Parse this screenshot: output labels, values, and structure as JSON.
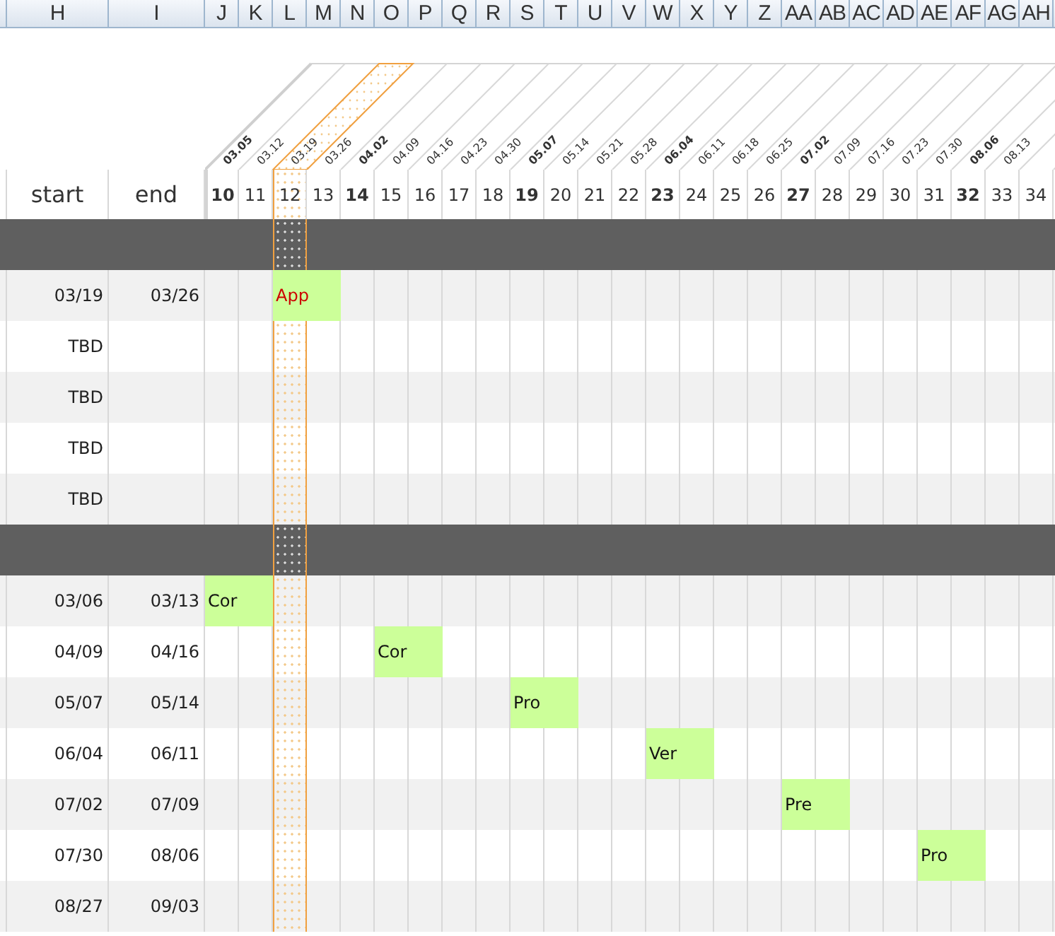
{
  "columns": [
    "H",
    "I",
    "J",
    "K",
    "L",
    "M",
    "N",
    "O",
    "P",
    "Q",
    "R",
    "S",
    "T",
    "U",
    "V",
    "W",
    "X",
    "Y",
    "Z",
    "AA",
    "AB",
    "AC",
    "AD",
    "AE",
    "AF",
    "AG",
    "AH"
  ],
  "headers": {
    "start": "start",
    "end": "end"
  },
  "weeks": [
    {
      "number": "10",
      "date": "03.05",
      "month_start": true,
      "current": false
    },
    {
      "number": "11",
      "date": "03.12",
      "month_start": false,
      "current": false
    },
    {
      "number": "12",
      "date": "03.19",
      "month_start": false,
      "current": true
    },
    {
      "number": "13",
      "date": "03.26",
      "month_start": false,
      "current": false
    },
    {
      "number": "14",
      "date": "04.02",
      "month_start": true,
      "current": false
    },
    {
      "number": "15",
      "date": "04.09",
      "month_start": false,
      "current": false
    },
    {
      "number": "16",
      "date": "04.16",
      "month_start": false,
      "current": false
    },
    {
      "number": "17",
      "date": "04.23",
      "month_start": false,
      "current": false
    },
    {
      "number": "18",
      "date": "04.30",
      "month_start": false,
      "current": false
    },
    {
      "number": "19",
      "date": "05.07",
      "month_start": true,
      "current": false
    },
    {
      "number": "20",
      "date": "05.14",
      "month_start": false,
      "current": false
    },
    {
      "number": "21",
      "date": "05.21",
      "month_start": false,
      "current": false
    },
    {
      "number": "22",
      "date": "05.28",
      "month_start": false,
      "current": false
    },
    {
      "number": "23",
      "date": "06.04",
      "month_start": true,
      "current": false
    },
    {
      "number": "24",
      "date": "06.11",
      "month_start": false,
      "current": false
    },
    {
      "number": "25",
      "date": "06.18",
      "month_start": false,
      "current": false
    },
    {
      "number": "26",
      "date": "06.25",
      "month_start": false,
      "current": false
    },
    {
      "number": "27",
      "date": "07.02",
      "month_start": true,
      "current": false
    },
    {
      "number": "28",
      "date": "07.09",
      "month_start": false,
      "current": false
    },
    {
      "number": "29",
      "date": "07.16",
      "month_start": false,
      "current": false
    },
    {
      "number": "30",
      "date": "07.23",
      "month_start": false,
      "current": false
    },
    {
      "number": "31",
      "date": "07.30",
      "month_start": false,
      "current": false
    },
    {
      "number": "32",
      "date": "08.06",
      "month_start": true,
      "current": false
    },
    {
      "number": "33",
      "date": "08.13",
      "month_start": false,
      "current": false
    },
    {
      "number": "34",
      "month_start": false,
      "current": false
    }
  ],
  "groups": [
    {
      "tasks": [
        {
          "start": "03/19",
          "end": "03/26",
          "bar": "App",
          "overdue": true
        },
        {
          "start": "TBD"
        },
        {
          "start": "TBD"
        },
        {
          "start": "TBD"
        },
        {
          "start": "TBD"
        }
      ]
    },
    {
      "tasks": [
        {
          "start": "03/06",
          "end": "03/13",
          "bar": "Cor",
          "overdue": false
        },
        {
          "start": "04/09",
          "end": "04/16",
          "bar": "Cor",
          "overdue": false
        },
        {
          "start": "05/07",
          "end": "05/14",
          "bar": "Pro",
          "overdue": false
        },
        {
          "start": "06/04",
          "end": "06/11",
          "bar": "Ver",
          "overdue": false
        },
        {
          "start": "07/02",
          "end": "07/09",
          "bar": "Pre",
          "overdue": false
        },
        {
          "start": "07/30",
          "end": "08/06",
          "bar": "Pro",
          "overdue": false
        },
        {
          "start": "08/27",
          "end": "09/03"
        }
      ]
    }
  ]
}
